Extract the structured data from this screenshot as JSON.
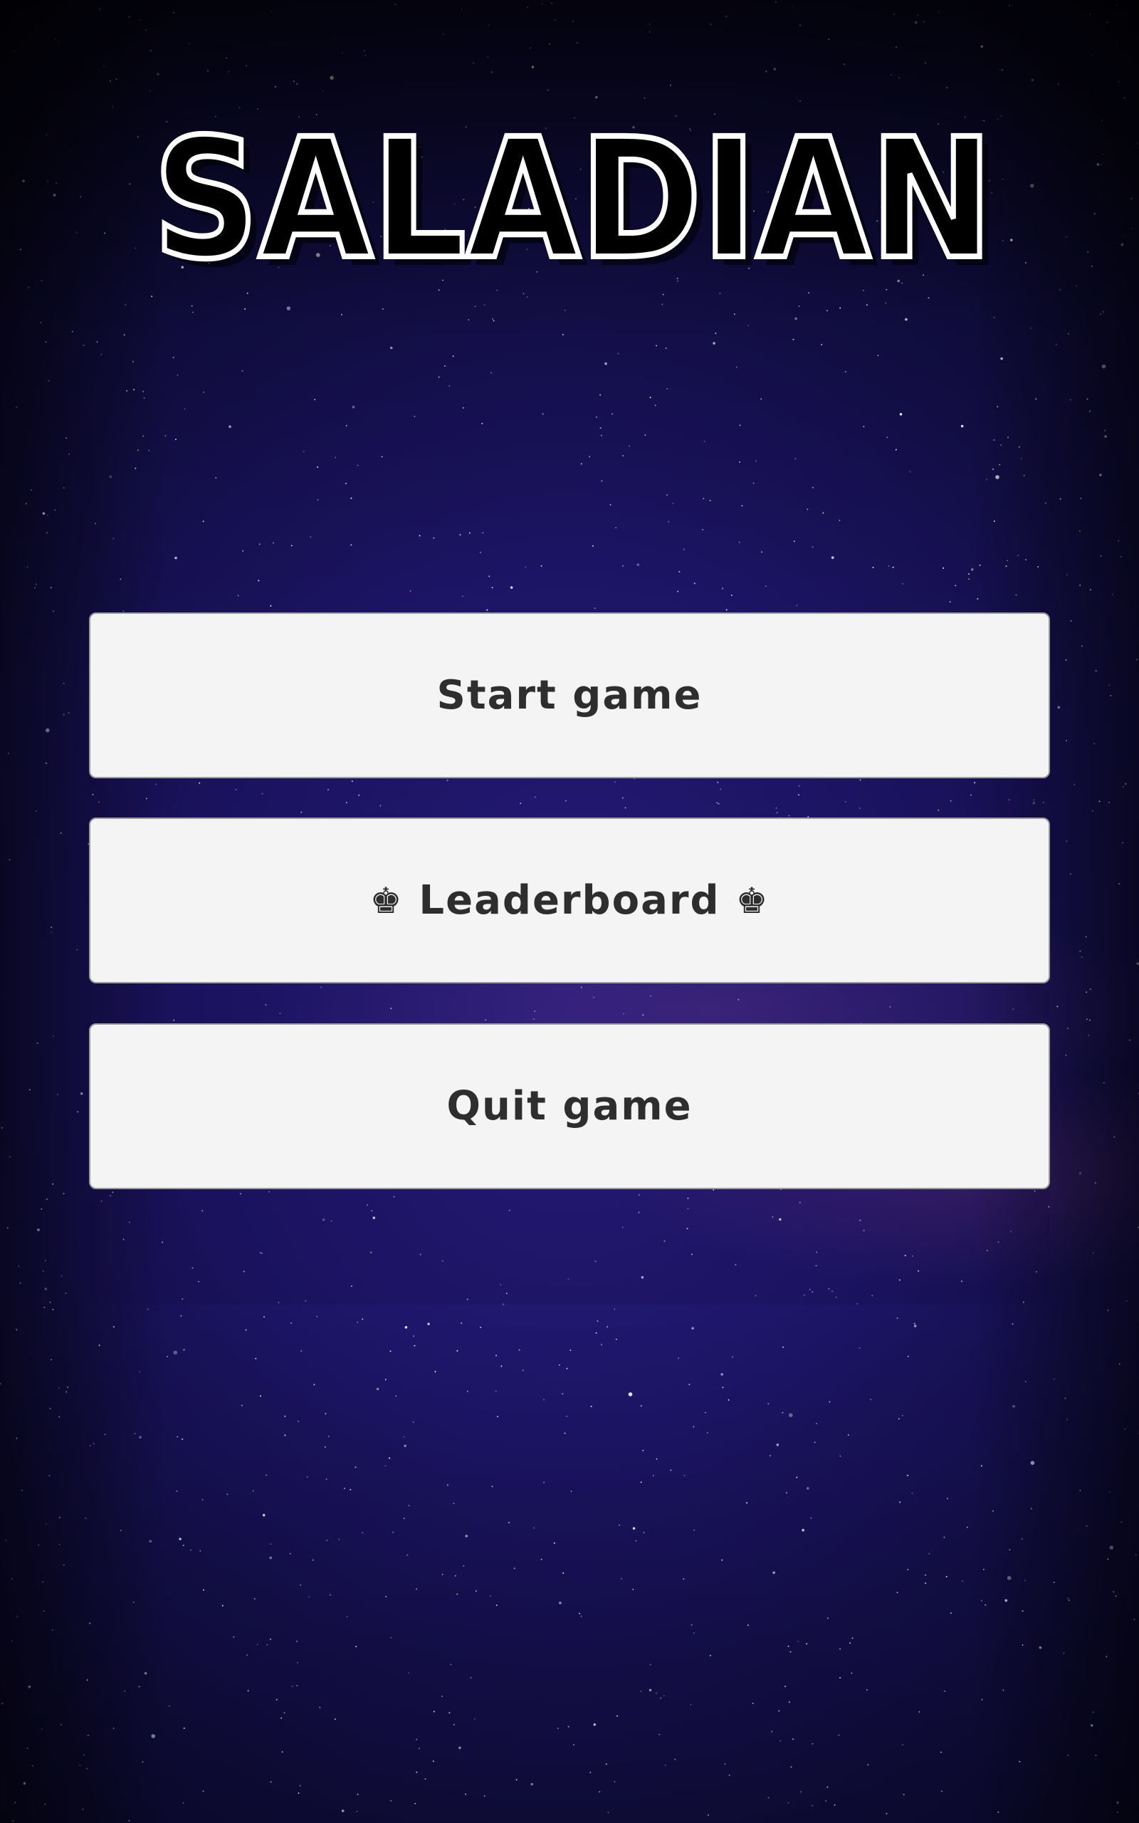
{
  "game": {
    "title": "SALADIAN"
  },
  "menu": {
    "start_label": "Start game",
    "leaderboard_label": "Leaderboard",
    "leaderboard_icon": "♚",
    "quit_label": "Quit game"
  },
  "colors": {
    "button_bg": "#f4f4f4",
    "button_text": "#2e2e2e",
    "sky_dark": "#07071e",
    "sky_mid": "#1d1568",
    "title_fill": "#000000",
    "title_stroke": "#ffffff"
  }
}
